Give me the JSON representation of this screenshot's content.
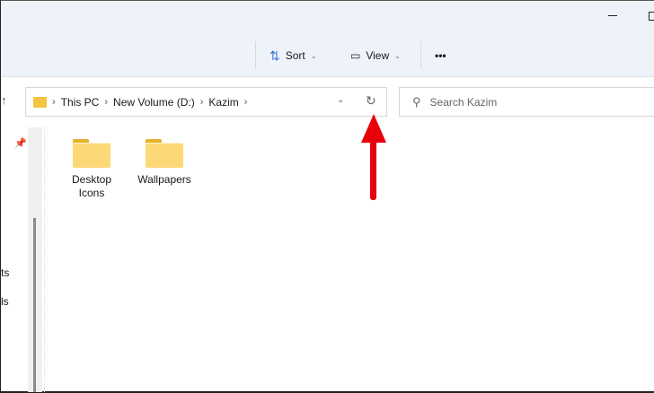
{
  "toolbar": {
    "sort_label": "Sort",
    "view_label": "View",
    "more_label": "•••"
  },
  "address": {
    "crumbs": [
      "This PC",
      "New Volume (D:)",
      "Kazim"
    ]
  },
  "search": {
    "placeholder": "Search Kazim"
  },
  "sidebar": {
    "partial_items": [
      "ts",
      "ls"
    ]
  },
  "files": [
    {
      "name_line1": "Desktop",
      "name_line2": "Icons"
    },
    {
      "name_line1": "Wallpapers",
      "name_line2": ""
    }
  ],
  "colors": {
    "annotation_arrow": "#e8000b",
    "folder": "#fcd877",
    "cmdbar": "#eef3fa"
  }
}
